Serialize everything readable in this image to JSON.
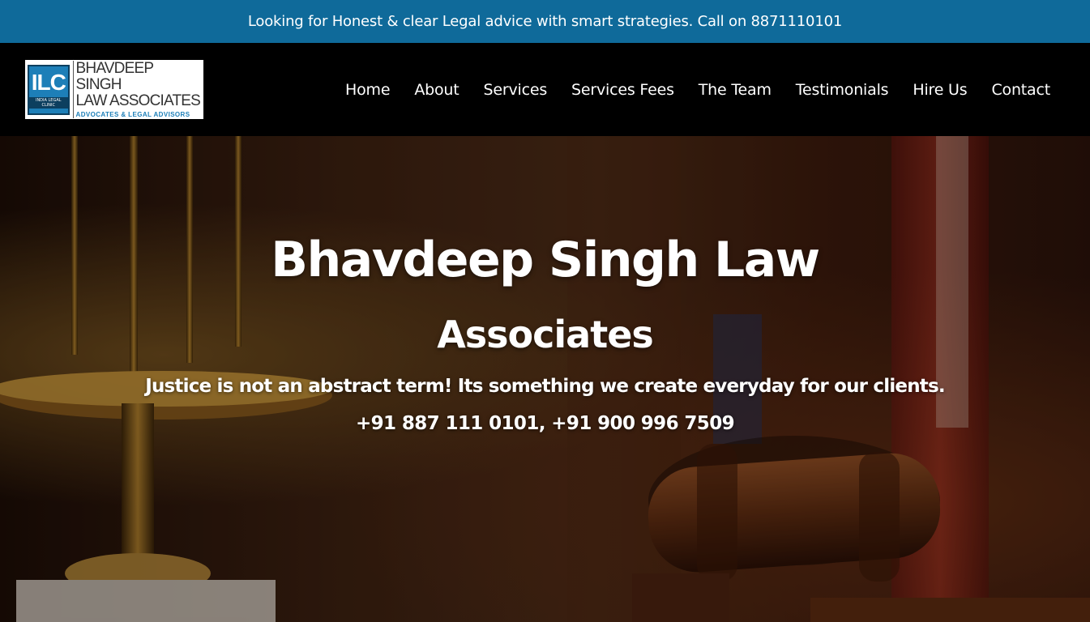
{
  "topbar": {
    "message": "Looking for Honest & clear Legal advice with smart strategies. Call on 8871110101"
  },
  "logo": {
    "mark": "ILC",
    "mark_sub": "INDIA LEGAL CLINIC",
    "line1": "BHAVDEEP SINGH",
    "line2": "LAW ASSOCIATES",
    "line3": "ADVOCATES & LEGAL ADVISORS"
  },
  "nav": {
    "items": [
      {
        "label": "Home"
      },
      {
        "label": "About"
      },
      {
        "label": "Services"
      },
      {
        "label": "Services Fees"
      },
      {
        "label": "The Team"
      },
      {
        "label": "Testimonials"
      },
      {
        "label": "Hire Us"
      },
      {
        "label": "Contact"
      }
    ]
  },
  "hero": {
    "title_line1": "Bhavdeep Singh Law",
    "title_line2": "Associates",
    "tagline": "Justice is not an abstract term! Its something we create everyday for our clients.",
    "phones": "+91 887 111 0101, +91 900 996 7509"
  },
  "colors": {
    "topbar": "#0f6a9a",
    "header": "#000000",
    "logo_accent": "#1d7fb8"
  }
}
